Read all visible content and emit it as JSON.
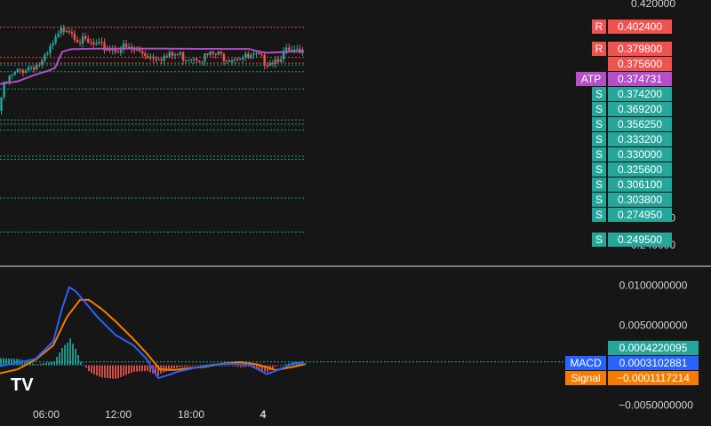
{
  "colors": {
    "background": "#161616",
    "resistance": "#ef5350",
    "support": "#26a69a",
    "atp": "#b34fc9",
    "macd": "#2962ff",
    "signal": "#f57c00",
    "text": "#d1d4dc"
  },
  "logo": {
    "text": "TV"
  },
  "chart_data": [
    {
      "type": "candlestick",
      "ylim": [
        0.23,
        0.42
      ],
      "yticks": [
        "0.420000",
        "0.260000",
        "0.240000"
      ],
      "levels": [
        {
          "tag": "R",
          "value": "0.402400",
          "num": 0.4024,
          "kind": "resistance"
        },
        {
          "tag": "R",
          "value": "0.379800",
          "num": 0.3798,
          "kind": "resistance"
        },
        {
          "tag": "",
          "value": "0.375600",
          "num": 0.3756,
          "kind": "resistance"
        },
        {
          "tag": "ATP",
          "value": "0.374731",
          "num": 0.374731,
          "kind": "atp"
        },
        {
          "tag": "S",
          "value": "0.374200",
          "num": 0.3742,
          "kind": "support"
        },
        {
          "tag": "S",
          "value": "0.369200",
          "num": 0.3692,
          "kind": "support"
        },
        {
          "tag": "S",
          "value": "0.356250",
          "num": 0.35625,
          "kind": "support"
        },
        {
          "tag": "S",
          "value": "0.333200",
          "num": 0.3332,
          "kind": "support"
        },
        {
          "tag": "S",
          "value": "0.330000",
          "num": 0.33,
          "kind": "support"
        },
        {
          "tag": "S",
          "value": "0.325600",
          "num": 0.3256,
          "kind": "support"
        },
        {
          "tag": "S",
          "value": "0.306100",
          "num": 0.3061,
          "kind": "support"
        },
        {
          "tag": "S",
          "value": "0.303800",
          "num": 0.3038,
          "kind": "support"
        },
        {
          "tag": "S",
          "value": "0.274950",
          "num": 0.27495,
          "kind": "support"
        },
        {
          "tag": "S",
          "value": "0.249500",
          "num": 0.2495,
          "kind": "support"
        }
      ],
      "price_path": [
        [
          0,
          0.34
        ],
        [
          3,
          0.352
        ],
        [
          6,
          0.36
        ],
        [
          12,
          0.366
        ],
        [
          20,
          0.37
        ],
        [
          30,
          0.374
        ],
        [
          40,
          0.376
        ],
        [
          50,
          0.378
        ],
        [
          55,
          0.383
        ],
        [
          58,
          0.388
        ],
        [
          62,
          0.392
        ],
        [
          66,
          0.396
        ],
        [
          70,
          0.401
        ],
        [
          76,
          0.405
        ],
        [
          82,
          0.402
        ],
        [
          90,
          0.395
        ],
        [
          100,
          0.392
        ],
        [
          110,
          0.39
        ],
        [
          120,
          0.389
        ],
        [
          130,
          0.388
        ],
        [
          140,
          0.389
        ],
        [
          150,
          0.387
        ],
        [
          160,
          0.386
        ],
        [
          170,
          0.383
        ],
        [
          180,
          0.383
        ],
        [
          190,
          0.382
        ],
        [
          200,
          0.384
        ],
        [
          210,
          0.382
        ],
        [
          220,
          0.383
        ],
        [
          230,
          0.382
        ],
        [
          240,
          0.384
        ],
        [
          250,
          0.383
        ],
        [
          260,
          0.382
        ],
        [
          270,
          0.383
        ],
        [
          280,
          0.381
        ],
        [
          290,
          0.382
        ],
        [
          300,
          0.379
        ],
        [
          310,
          0.38
        ],
        [
          318,
          0.384
        ],
        [
          325,
          0.386
        ],
        [
          332,
          0.385
        ],
        [
          340,
          0.384
        ]
      ],
      "atp_path": [
        [
          0,
          0.36
        ],
        [
          20,
          0.362
        ],
        [
          40,
          0.367
        ],
        [
          55,
          0.37
        ],
        [
          62,
          0.372
        ],
        [
          70,
          0.384
        ],
        [
          80,
          0.386
        ],
        [
          100,
          0.3863
        ],
        [
          150,
          0.3865
        ],
        [
          200,
          0.3863
        ],
        [
          250,
          0.3862
        ],
        [
          280,
          0.3862
        ],
        [
          290,
          0.3843
        ],
        [
          300,
          0.3833
        ],
        [
          320,
          0.3838
        ],
        [
          340,
          0.3847
        ]
      ]
    },
    {
      "type": "macd",
      "yticks": [
        "0.0100000000",
        "0.0050000000"
      ],
      "ylim": [
        -0.0065,
        0.0113
      ],
      "macd_path": [
        [
          0,
          -0.0001
        ],
        [
          20,
          0.0003
        ],
        [
          40,
          0.0008
        ],
        [
          60,
          0.003
        ],
        [
          70,
          0.0072
        ],
        [
          78,
          0.0098
        ],
        [
          85,
          0.0093
        ],
        [
          95,
          0.008
        ],
        [
          110,
          0.006
        ],
        [
          130,
          0.0038
        ],
        [
          150,
          0.0025
        ],
        [
          165,
          0.0008
        ],
        [
          178,
          -0.0016
        ],
        [
          190,
          -0.0012
        ],
        [
          200,
          -0.0008
        ],
        [
          220,
          -0.0003
        ],
        [
          240,
          0.0001
        ],
        [
          260,
          0.0002
        ],
        [
          280,
          0.0001
        ],
        [
          300,
          -0.0011
        ],
        [
          315,
          -0.0005
        ],
        [
          330,
          0.0002
        ],
        [
          342,
          0.0004
        ]
      ],
      "signal_path": [
        [
          0,
          -0.001
        ],
        [
          20,
          -0.0005
        ],
        [
          40,
          0.0007
        ],
        [
          60,
          0.0025
        ],
        [
          75,
          0.006
        ],
        [
          90,
          0.0082
        ],
        [
          100,
          0.0082
        ],
        [
          115,
          0.007
        ],
        [
          130,
          0.0055
        ],
        [
          150,
          0.0033
        ],
        [
          165,
          0.0015
        ],
        [
          180,
          -0.0005
        ],
        [
          195,
          -0.0006
        ],
        [
          210,
          -0.0004
        ],
        [
          230,
          -0.0002
        ],
        [
          250,
          0.0002
        ],
        [
          270,
          0.0004
        ],
        [
          290,
          0.0001
        ],
        [
          310,
          -0.0006
        ],
        [
          330,
          -0.0002
        ],
        [
          342,
          0.0001
        ]
      ],
      "labels": [
        {
          "tag": "",
          "value": "0.0004220095",
          "num": 0.0004220095,
          "kind": "support"
        },
        {
          "tag": "MACD",
          "value": "0.0003102881",
          "num": 0.0003102881,
          "kind": "macd"
        },
        {
          "tag": "Signal",
          "value": "−0.0001117214",
          "num": -0.0001117214,
          "kind": "signal"
        }
      ],
      "extra_ticks": [
        "−0.0050000000"
      ]
    }
  ],
  "xticks": [
    {
      "label": "06:00",
      "num": 52
    },
    {
      "label": "12:00",
      "num": 133
    },
    {
      "label": "18:00",
      "num": 215
    },
    {
      "label": "4",
      "num": 296
    }
  ]
}
